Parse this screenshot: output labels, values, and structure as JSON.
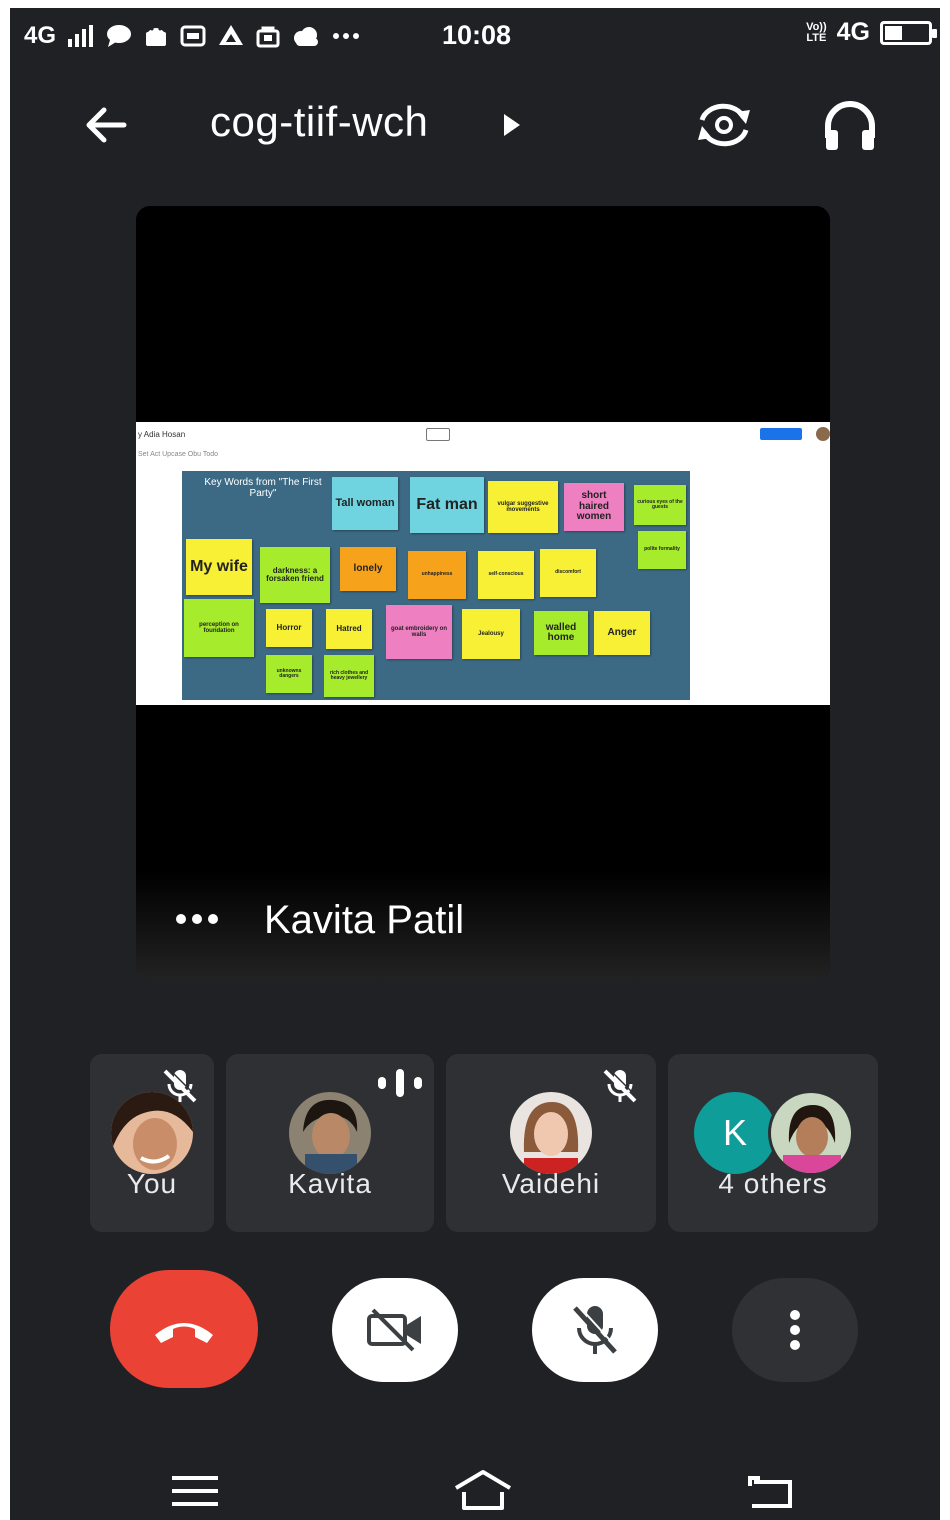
{
  "status_bar": {
    "network_left": "4G",
    "time": "10:08",
    "volte_top": "Vo))",
    "volte_bottom": "LTE",
    "network_right": "4G",
    "battery_level": 0.4
  },
  "header": {
    "meeting_code": "cog-tiif-wch"
  },
  "presentation": {
    "presenter_name": "Kavita Patil",
    "doc_title": "y Adia Hosan",
    "doc_subtitle": "Set Act Upcase    Obu Todo",
    "share_label": "Share",
    "board_title": "Key Words from \"The First Party\"",
    "notes": [
      {
        "text": "Tall woman",
        "color": "#6fd3e0"
      },
      {
        "text": "Fat man",
        "color": "#6fd3e0"
      },
      {
        "text": "vulgar suggestive movements",
        "color": "#f7f035"
      },
      {
        "text": "short haired women",
        "color": "#ee7fc0"
      },
      {
        "text": "curious eyes of the guests",
        "color": "#a6ec2c"
      },
      {
        "text": "polite formality",
        "color": "#a6ec2c"
      },
      {
        "text": "My wife",
        "color": "#f7f035"
      },
      {
        "text": "darkness: a forsaken friend",
        "color": "#a6ec2c"
      },
      {
        "text": "lonely",
        "color": "#f7a21b"
      },
      {
        "text": "unhappiness",
        "color": "#f7a21b"
      },
      {
        "text": "self-conscious",
        "color": "#f7f035"
      },
      {
        "text": "discomfort",
        "color": "#f7f035"
      },
      {
        "text": "perception on foundation",
        "color": "#a6ec2c"
      },
      {
        "text": "Horror",
        "color": "#f7f035"
      },
      {
        "text": "Hatred",
        "color": "#f7f035"
      },
      {
        "text": "goat embroidery on walls",
        "color": "#ee7fc0"
      },
      {
        "text": "Jealousy",
        "color": "#f7f035"
      },
      {
        "text": "walled home",
        "color": "#a6ec2c"
      },
      {
        "text": "Anger",
        "color": "#f7f035"
      },
      {
        "text": "unknowns dangers",
        "color": "#a6ec2c"
      },
      {
        "text": "rich clothes and heavy jewellery",
        "color": "#a6ec2c"
      }
    ]
  },
  "participants": [
    {
      "name": "You",
      "muted": true,
      "speaking": false
    },
    {
      "name": "Kavita",
      "muted": false,
      "speaking": true
    },
    {
      "name": "Vaidehi",
      "muted": true,
      "speaking": false
    },
    {
      "name": "4 others",
      "initial": "K",
      "muted": false,
      "speaking": false
    }
  ],
  "colors": {
    "background": "#202124",
    "end_call": "#ea4335",
    "tile": "#2e3033",
    "k_avatar": "#0f9d9a"
  },
  "icons": [
    "back-arrow-icon",
    "play-arrow-icon",
    "switch-camera-icon",
    "headphones-icon",
    "more-dots-icon",
    "mic-off-icon",
    "speaking-indicator-icon",
    "end-call-icon",
    "camera-off-icon",
    "more-vert-icon",
    "nav-menu-icon",
    "nav-home-icon",
    "nav-back-icon"
  ]
}
